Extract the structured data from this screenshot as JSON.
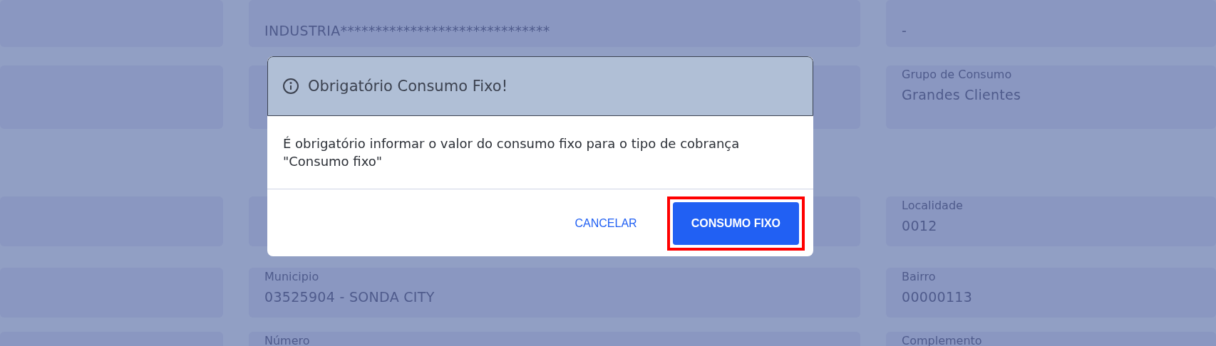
{
  "form": {
    "rows": [
      {
        "cells": [
          {},
          {
            "value": "INDUSTRIA******************************"
          },
          {
            "value": "-"
          }
        ]
      },
      {
        "cells": [
          {},
          {},
          {
            "label": "Grupo de Consumo",
            "value": "Grandes Clientes"
          }
        ]
      },
      {
        "cells": [
          {},
          {},
          {
            "label": "Localidade",
            "value": "0012"
          }
        ]
      },
      {
        "cells": [
          {},
          {
            "label": "Municipio",
            "value": "03525904 - SONDA CITY"
          },
          {
            "label": "Bairro",
            "value": "00000113"
          }
        ]
      },
      {
        "cells": [
          {},
          {
            "label": "Número"
          },
          {
            "label": "Complemento"
          }
        ]
      }
    ]
  },
  "dialog": {
    "title": "Obrigatório Consumo Fixo!",
    "message": "É obrigatório informar o valor do consumo fixo para o tipo de cobrança \"Consumo fixo\"",
    "buttons": [
      {
        "label": "CANCELAR",
        "kind": "text",
        "highlighted": false
      },
      {
        "label": "CONSUMO FIXO",
        "kind": "primary",
        "highlighted": true
      }
    ]
  }
}
